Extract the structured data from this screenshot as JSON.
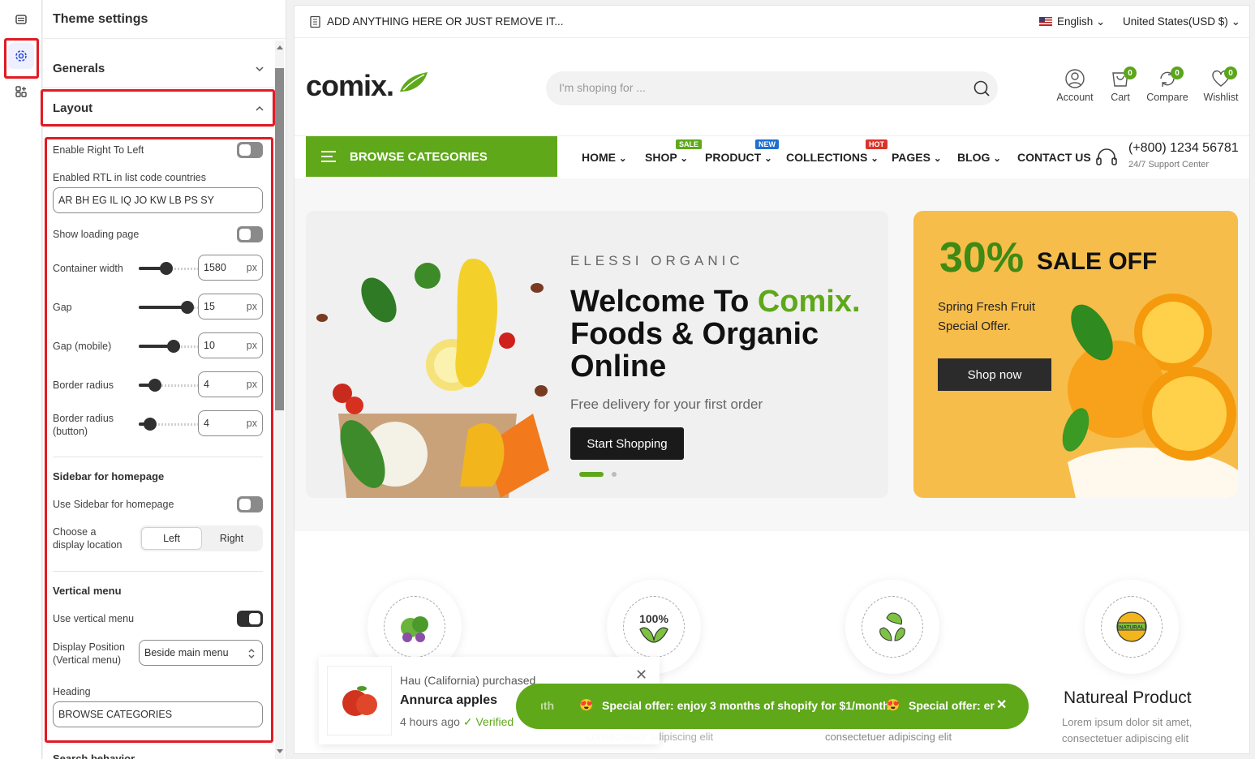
{
  "panel": {
    "title": "Theme settings",
    "generals": "Generals",
    "layout": "Layout",
    "enable_rtl": "Enable Right To Left",
    "rtl_countries_label": "Enabled RTL in list code countries",
    "rtl_countries_value": "AR BH EG IL IQ JO KW LB PS SY",
    "show_loading": "Show loading page",
    "container_width": {
      "label": "Container width",
      "value": "1580",
      "unit": "px",
      "level": 0.45
    },
    "gap": {
      "label": "Gap",
      "value": "15",
      "unit": "px",
      "level": 0.9
    },
    "gap_mobile": {
      "label": "Gap (mobile)",
      "value": "10",
      "unit": "px",
      "level": 0.6
    },
    "border_radius": {
      "label": "Border radius",
      "value": "4",
      "unit": "px",
      "level": 0.2
    },
    "border_radius_button": {
      "label": "Border radius",
      "label2": "(button)",
      "value": "4",
      "unit": "px",
      "level": 0.1
    },
    "sidebar_heading": "Sidebar for homepage",
    "use_sidebar": "Use Sidebar for homepage",
    "display_location": "Choose a",
    "display_location2": "display location",
    "loc_left": "Left",
    "loc_right": "Right",
    "vertical_heading": "Vertical menu",
    "use_vertical": "Use vertical menu",
    "display_position": "Display Position",
    "display_position2": "(Vertical menu)",
    "display_position_value": "Beside main menu",
    "heading_label": "Heading",
    "heading_value": "BROWSE CATEGORIES",
    "next_section": "Search behavior"
  },
  "store": {
    "announcement": "ADD ANYTHING HERE OR JUST REMOVE IT...",
    "language": "English",
    "currency": "United States(USD $)",
    "logo": "comix.",
    "search_placeholder": "I'm shoping for ...",
    "account": "Account",
    "cart": "Cart",
    "compare": "Compare",
    "wishlist": "Wishlist",
    "cart_count": "0",
    "compare_count": "0",
    "wishlist_count": "0",
    "browse": "BROWSE CATEGORIES",
    "nav": [
      "HOME",
      "SHOP",
      "PRODUCT",
      "COLLECTIONS",
      "PAGES",
      "BLOG",
      "CONTACT US"
    ],
    "tag_sale": "SALE",
    "tag_new": "NEW",
    "tag_hot": "HOT",
    "phone": "(+800) 1234 56781",
    "support": "24/7 Support Center",
    "hero_kicker": "ELESSI ORGANIC",
    "hero_title1": "Welcome To ",
    "hero_title_brand": "Comix.",
    "hero_title2": "Foods & Organic",
    "hero_title3": "Online",
    "hero_sub": "Free delivery for your first order",
    "hero_btn": "Start Shopping",
    "sale_pct": "30%",
    "sale_off": "SALE OFF",
    "sale_sub1": "Spring Fresh Fruit",
    "sale_sub2": "Special Offer.",
    "sale_btn": "Shop now",
    "feature4_title": "Natureal Product",
    "feature_desc1": "Lorem ipsum dolor sit amet,",
    "feature_desc2": "consectetuer adipiscing elit",
    "popup_who": "Hau (California) purchased",
    "popup_product": "Annurca apples",
    "popup_time": "4 hours ago",
    "popup_verified": "Verified",
    "offer_text": "Special offer: enjoy 3 months of shopify for $1/month",
    "offer_text2": "Special offer: er",
    "offer_lead": "ıth"
  },
  "colors": {
    "accent": "#5fa81a",
    "highlight": "#e01b24",
    "sale_bg": "#f7bd4a"
  }
}
